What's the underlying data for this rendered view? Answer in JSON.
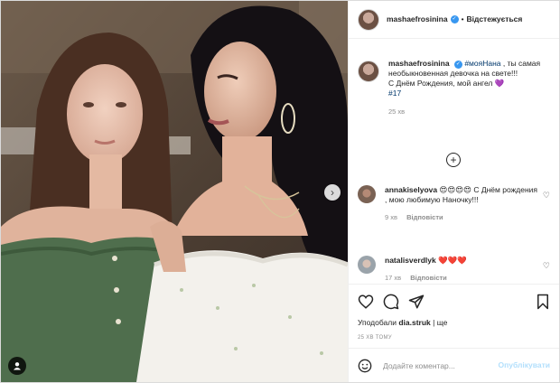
{
  "header": {
    "username": "mashaefrosinina",
    "follow_label": "Відстежується"
  },
  "caption": {
    "username": "mashaefrosinina",
    "hashtag": "#мояНана",
    "text_after_hashtag": ", ты самая необыкновенная девочка на свете!!!",
    "line2": "С Днём Рождения, мой ангел",
    "heart": "💜",
    "line3": "#17",
    "time": "25 хв"
  },
  "comments": [
    {
      "username": "annakiselyova",
      "emojis": "😍😍😍😍",
      "text": "С Днём рождения , мою любимую Наночку!!!",
      "time": "9 хв",
      "reply_label": "Відповісти"
    },
    {
      "username": "natalisverdlyk",
      "emojis": "❤️❤️❤️",
      "text": "",
      "time": "17 хв",
      "reply_label": "Відповісти"
    }
  ],
  "likes": {
    "prefix": "Уподобали",
    "user": "dia.struk",
    "suffix": "| ще"
  },
  "timestamp": "25 ХВ ТОМУ",
  "comment_box": {
    "placeholder": "Додайте коментар...",
    "publish_label": "Опублікувати"
  },
  "icons": {
    "more": "plus-circle-icon",
    "next": "chevron-right-icon",
    "tag": "user-tag-icon",
    "like": "heart-icon",
    "comment": "comment-icon",
    "share": "paper-plane-icon",
    "save": "bookmark-icon",
    "emoji": "smiley-icon"
  },
  "colors": {
    "link": "#00376b",
    "publish_disabled": "#b2dffc",
    "secondary_text": "#8e8e8e",
    "verified": "#3897f0"
  }
}
